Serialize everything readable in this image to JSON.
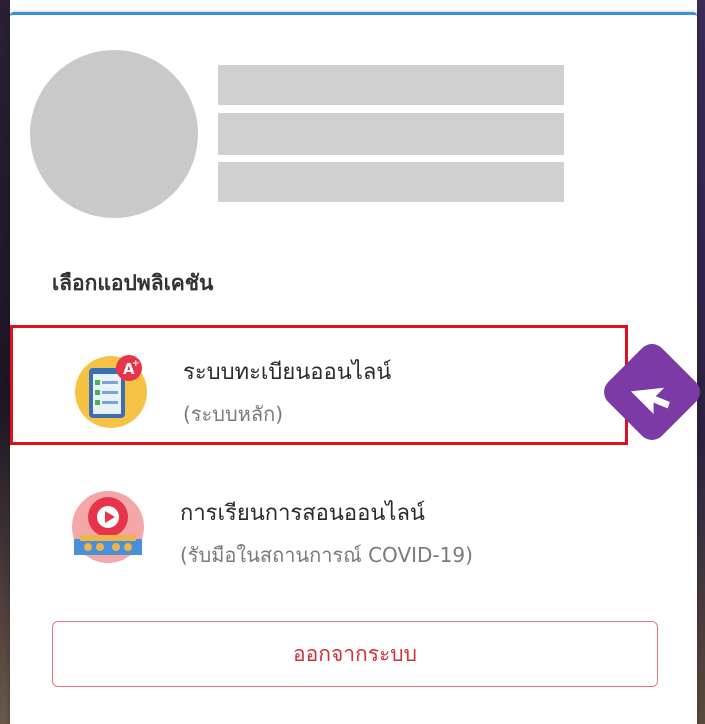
{
  "section": {
    "label": "เลือกแอปพลิเคชัน"
  },
  "apps": [
    {
      "title": "ระบบทะเบียนออนไลน์",
      "subtitle": "(ระบบหลัก)",
      "icon": "registration-clipboard-icon",
      "selected": true
    },
    {
      "title": "การเรียนการสอนออนไลน์",
      "subtitle": "(รับมือในสถานการณ์ COVID-19)",
      "icon": "online-class-video-icon",
      "selected": false
    }
  ],
  "logout": {
    "label": "ออกจากระบบ"
  },
  "colors": {
    "accent_top": "#3f8fd8",
    "highlight": "#e0101a",
    "logout_text": "#d0303a",
    "cursor_badge": "#7b3aa6"
  }
}
